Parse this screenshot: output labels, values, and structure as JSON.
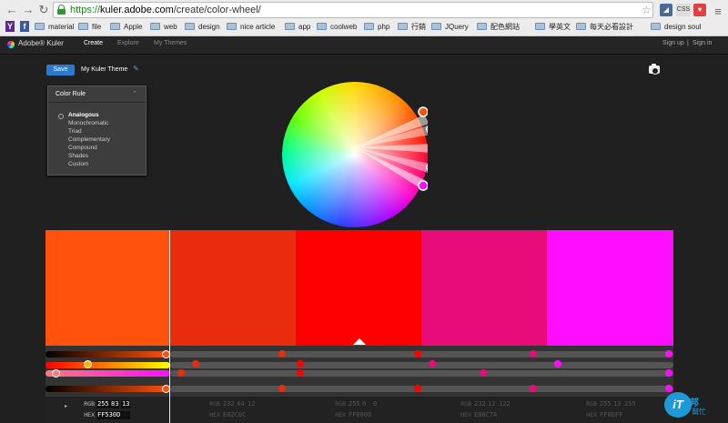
{
  "browser": {
    "url_scheme": "https://",
    "url_domain": "kuler.adobe.com",
    "url_path": "/create/color-wheel/",
    "bookmarks": [
      "material",
      "file",
      "Apple",
      "web",
      "design",
      "nice article",
      "app",
      "coolweb",
      "php",
      "行銷",
      "JQuery",
      "配色網站",
      "學英文",
      "每天必看設計",
      "design soul"
    ],
    "extension_css": "CSS"
  },
  "app": {
    "logo": "Adobe® Kuler",
    "nav": [
      "Create",
      "Explore",
      "My Themes"
    ],
    "sign_up": "Sign up",
    "separator": "|",
    "sign_in": "Sign in"
  },
  "toolbar": {
    "save_label": "Save",
    "theme_name": "My Kuler Theme"
  },
  "color_rule": {
    "title": "Color Rule",
    "options": [
      "Analogous",
      "Monochromatic",
      "Triad",
      "Complementary",
      "Compound",
      "Shades",
      "Custom"
    ],
    "selected": "Analogous"
  },
  "swatches": [
    {
      "hex": "#FF530D",
      "rgb": [
        "255",
        "83",
        "13"
      ],
      "hex_label": "FF530D"
    },
    {
      "hex": "#E82C0C",
      "rgb": [
        "232",
        "44",
        "12"
      ],
      "hex_label": "E82C0C"
    },
    {
      "hex": "#FF0000",
      "rgb": [
        "255",
        "0",
        "0"
      ],
      "hex_label": "FF0000"
    },
    {
      "hex": "#E80C7A",
      "rgb": [
        "232",
        "12",
        "122"
      ],
      "hex_label": "E80C7A"
    },
    {
      "hex": "#FF0DFF",
      "rgb": [
        "255",
        "13",
        "255"
      ],
      "hex_label": "FF0DFF"
    }
  ],
  "values_labels": {
    "rgb": "RGB",
    "hex": "HEX"
  },
  "watermark": {
    "badge": "iT",
    "line1": "邦",
    "line2": "幫忙"
  }
}
